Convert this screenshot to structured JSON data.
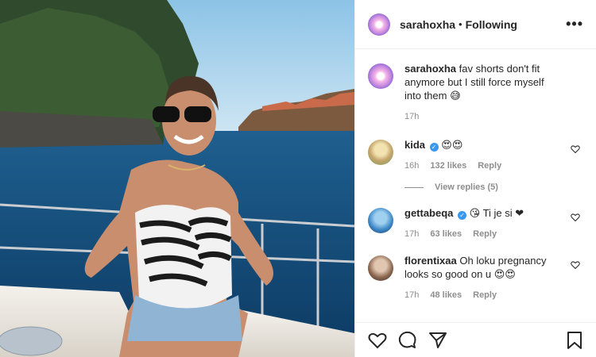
{
  "header": {
    "username": "sarahoxha",
    "separator": "•",
    "follow_status": "Following",
    "more_label": "•••"
  },
  "caption": {
    "username": "sarahoxha",
    "text": "fav shorts don't fit anymore but I still force myself into them 😅",
    "time": "17h"
  },
  "comments": [
    {
      "username": "kida",
      "verified": true,
      "text": "😍😍",
      "time": "16h",
      "likes": "132 likes",
      "reply": "Reply"
    },
    {
      "username": "gettabeqa",
      "verified": true,
      "text": "😘 Ti je si ❤",
      "time": "17h",
      "likes": "63 likes",
      "reply": "Reply"
    },
    {
      "username": "florentixaa",
      "verified": false,
      "text": "Oh loku pregnancy looks so good on u 😍😍",
      "time": "17h",
      "likes": "48 likes",
      "reply": "Reply"
    }
  ],
  "view_replies": "View replies (5)",
  "icons": {
    "like": "heart-icon",
    "comment": "comment-icon",
    "share": "share-icon",
    "save": "bookmark-icon",
    "more": "more-options-icon",
    "verified": "verified-badge-icon"
  },
  "colors": {
    "text": "#262626",
    "muted": "#8e8e8e",
    "verified": "#3897f0",
    "border": "#efefef"
  }
}
